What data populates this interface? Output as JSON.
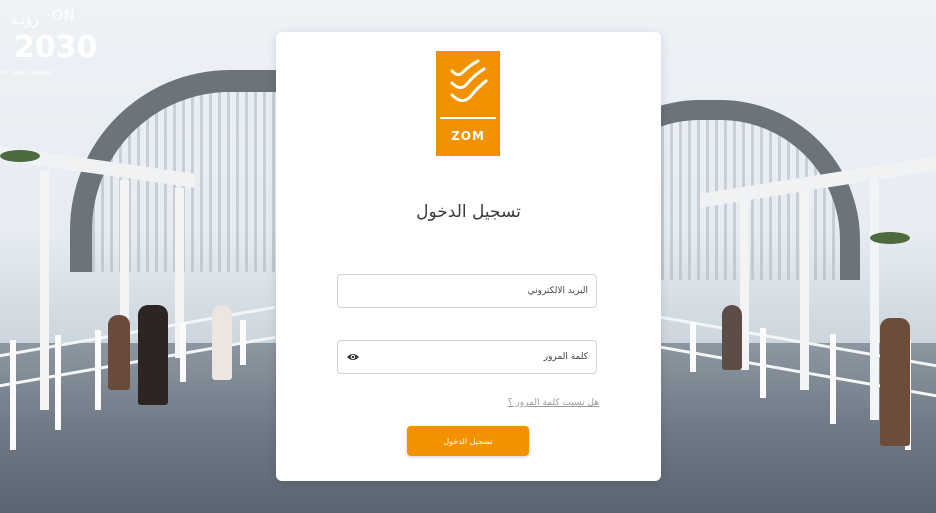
{
  "vision_logo": {
    "arabic": "رؤيـة",
    "latin_partial": "ON",
    "number": "2030",
    "ksa_line": "OF SAUDI ARABIA"
  },
  "brand": {
    "name": "ZOM",
    "color": "#f39200"
  },
  "login": {
    "title": "تسجيل الدخول",
    "email_placeholder": "البريد الالكتروني",
    "password_placeholder": "كلمة المرور",
    "forgot_password": "هل نسيت كلمة المرور ؟",
    "submit_label": "تسجيل الدخول",
    "eye_icon": "eye-icon"
  }
}
